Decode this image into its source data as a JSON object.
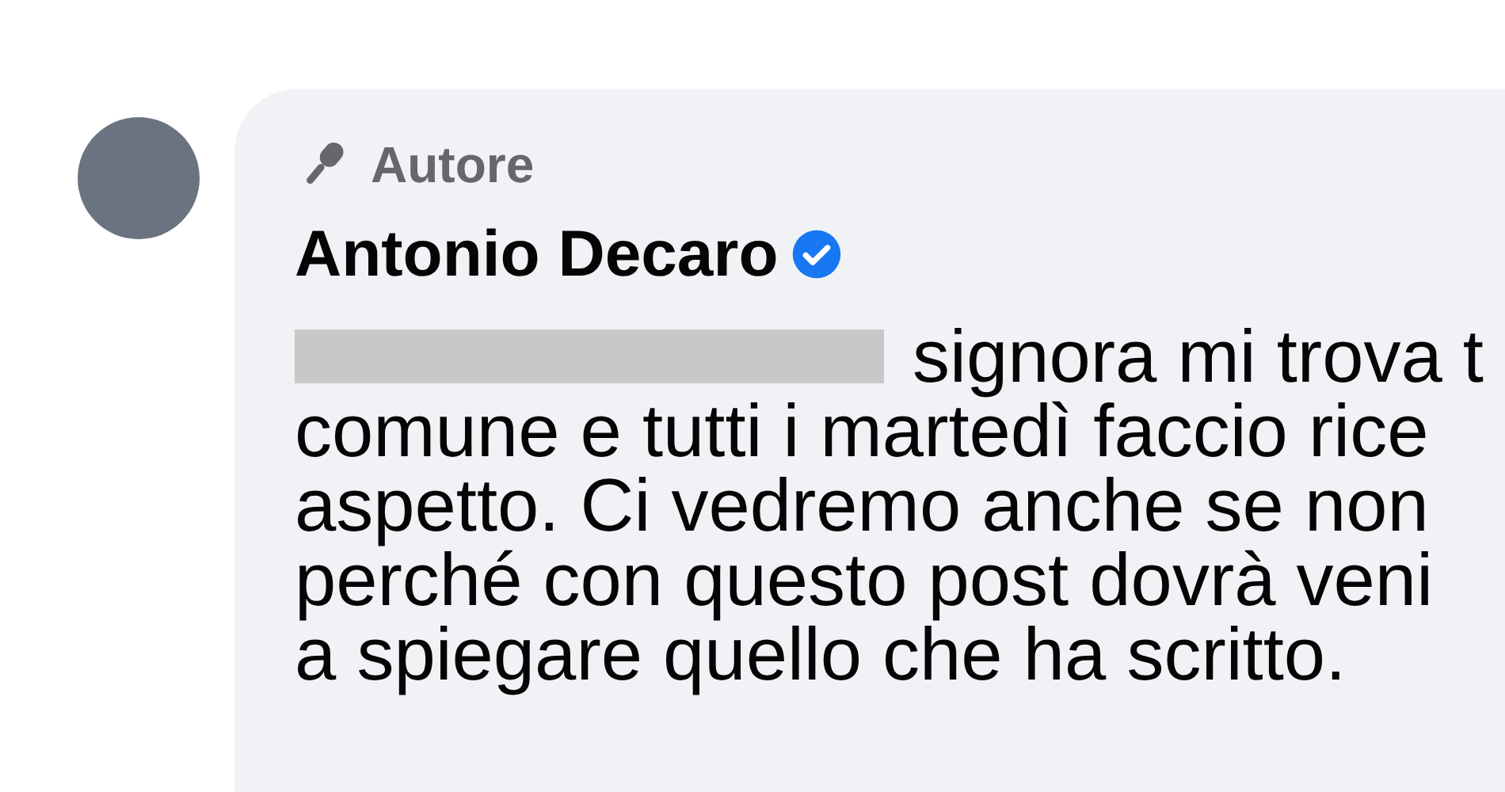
{
  "comment": {
    "badge": "Autore",
    "author": "Antonio Decaro",
    "verified": true,
    "lines": [
      "signora mi trova t",
      "comune e tutti i martedì faccio rice",
      "aspetto. Ci vedremo anche se non",
      "perché con questo post dovrà veni",
      "a spiegare quello che ha scritto."
    ]
  }
}
